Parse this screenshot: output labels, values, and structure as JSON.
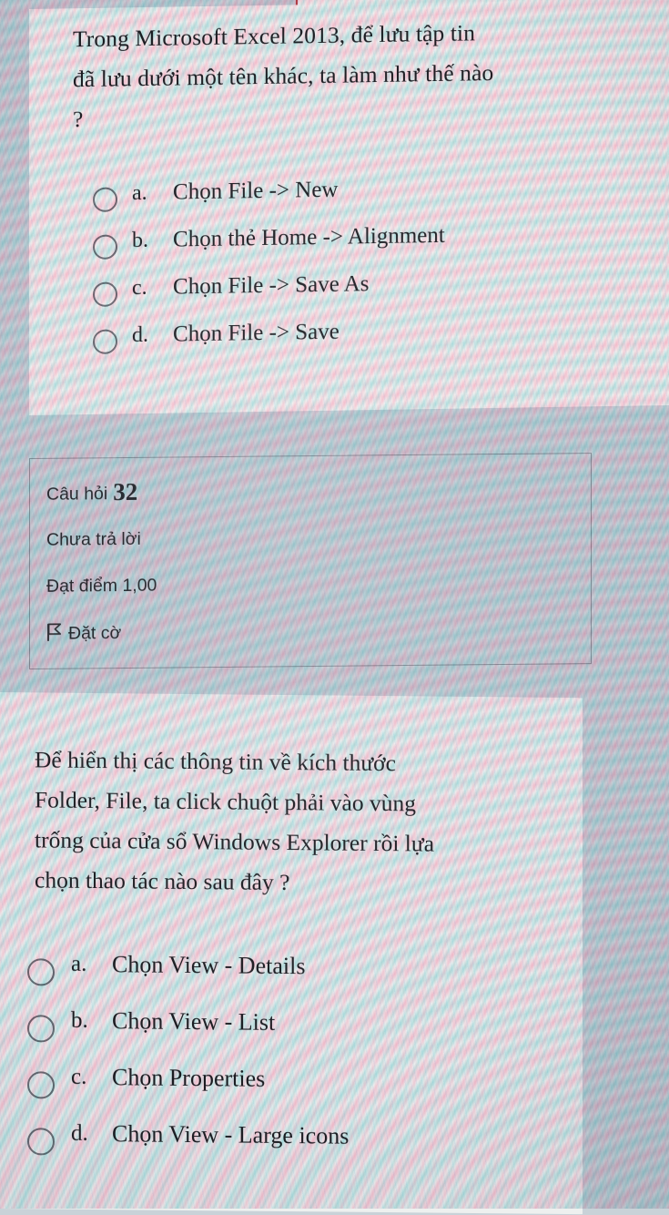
{
  "page": {
    "language": "vi",
    "background_color": "#c9d2d8",
    "card_color": "#f2f1ef",
    "text_color": "#1c1d22",
    "accent_red": "#b0464c",
    "border_color": "#8b919a"
  },
  "top_partial_box": {
    "border_color": "#b0464c",
    "note_visible_text": ""
  },
  "questions": [
    {
      "id": "q-excel-save-as",
      "stem": "Trong Microsoft Excel 2013, để lưu tập tin đã lưu dưới một tên khác, ta làm như thế nào ?",
      "stem_lines": [
        "Trong Microsoft Excel 2013, để lưu tập tin",
        "đã lưu dưới một tên khác, ta làm như thế nào",
        "?"
      ],
      "options": [
        {
          "letter": "a.",
          "text": "Chọn File -> New",
          "selected": false
        },
        {
          "letter": "b.",
          "text": "Chọn thẻ Home -> Alignment",
          "selected": false
        },
        {
          "letter": "c.",
          "text": "Chọn File -> Save As",
          "selected": false
        },
        {
          "letter": "d.",
          "text": "Chọn File -> Save",
          "selected": false
        }
      ]
    },
    {
      "id": "q-explorer-details",
      "stem": "Để hiển thị các thông tin về kích thước Folder, File, ta click chuột phải vào vùng trống của cửa sổ Windows Explorer rồi lựa chọn thao tác nào sau đây ?",
      "stem_lines": [
        "Để hiển thị các thông tin về kích thước",
        "Folder, File, ta click chuột phải vào vùng",
        "trống của cửa sổ Windows Explorer rồi lựa",
        "chọn thao tác nào sau đây ?"
      ],
      "options": [
        {
          "letter": "a.",
          "text": "Chọn View - Details",
          "selected": false
        },
        {
          "letter": "b.",
          "text": "Chọn View - List",
          "selected": false
        },
        {
          "letter": "c.",
          "text": "Chọn Properties",
          "selected": false
        },
        {
          "letter": "d.",
          "text": "Chọn View - Large icons",
          "selected": false
        }
      ]
    }
  ],
  "question_info": {
    "question_label": "Câu hỏi",
    "question_number": "32",
    "answer_status": "Chưa trả lời",
    "grade_label": "Đạt điểm 1,00",
    "flag_label": "Đặt cờ",
    "flag_icon": "flag-outline-icon"
  }
}
